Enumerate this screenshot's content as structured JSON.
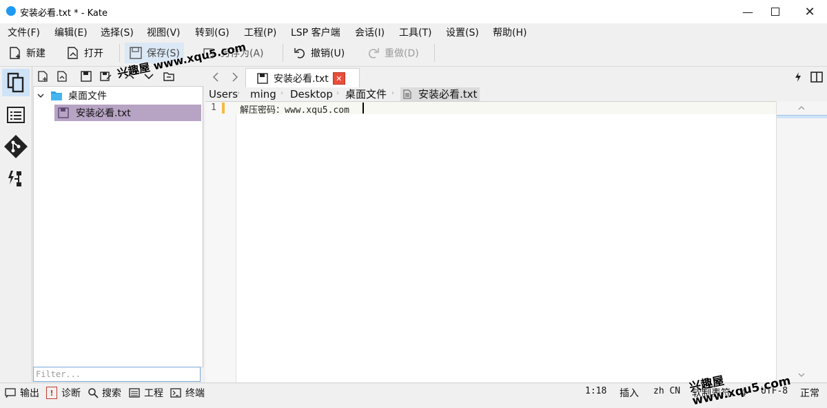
{
  "window": {
    "title": "安装必看.txt * - Kate"
  },
  "menu": [
    "文件(F)",
    "编辑(E)",
    "选择(S)",
    "视图(V)",
    "转到(G)",
    "工程(P)",
    "LSP 客户端",
    "会话(I)",
    "工具(T)",
    "设置(S)",
    "帮助(H)"
  ],
  "toolbar": {
    "new": "新建",
    "open": "打开",
    "save": "保存(S)",
    "save_as": "另存为(A)",
    "undo": "撤销(U)",
    "redo": "重做(D)"
  },
  "file_tree": {
    "folder": "桌面文件",
    "file": "安装必看.txt",
    "filter_placeholder": "Filter..."
  },
  "tab": {
    "label": "安装必看.txt"
  },
  "breadcrumb": [
    "Users",
    "ming",
    "Desktop",
    "桌面文件",
    "安装必看.txt"
  ],
  "editor": {
    "line_number": "1",
    "text": "解压密码：www.xqu5.com"
  },
  "statusbar": {
    "output": "输出",
    "diagnostics": "诊断",
    "search": "搜索",
    "project": "工程",
    "terminal": "终端",
    "cursor": "1:18",
    "mode": "插入",
    "lang": "zh CN",
    "indent": "软制表符：4",
    "encoding": "UTF-8",
    "eol": "正常"
  },
  "watermarks": {
    "top": "兴趣屋 www.xqu5.com",
    "bottom": "兴趣屋 www.xqu5.com"
  },
  "colors": {
    "accent": "#1d99f3",
    "selection": "#b7a3c3",
    "modified": "#f5b942",
    "close_tab": "#e94e3c"
  }
}
